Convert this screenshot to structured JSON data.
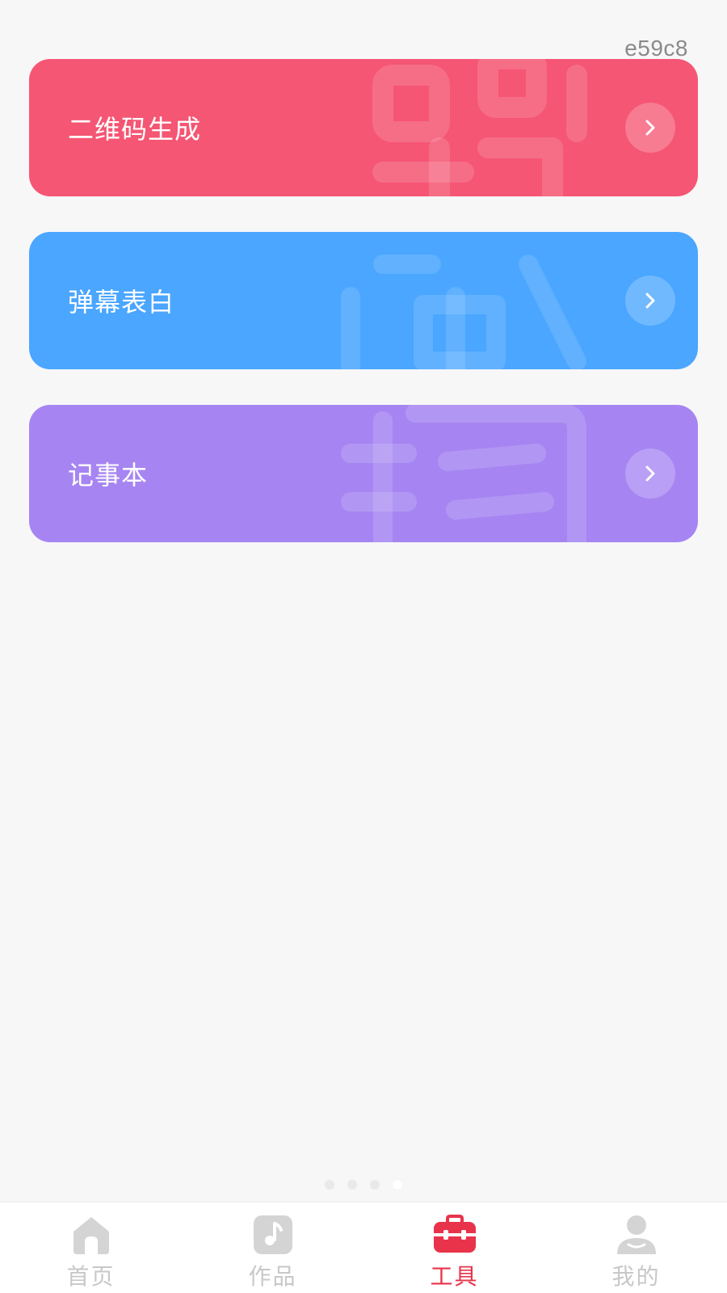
{
  "corner_tag": "e59c8",
  "cards": [
    {
      "title": "二维码生成",
      "icon": "chevron-right-icon",
      "color": "#f55673"
    },
    {
      "title": "弹幕表白",
      "icon": "chevron-right-icon",
      "color": "#4aa6ff"
    },
    {
      "title": "记事本",
      "icon": "chevron-right-icon",
      "color": "#a685f2"
    }
  ],
  "pager": {
    "count": 4,
    "active_index": 3
  },
  "tabbar": {
    "active_color": "#e8334a",
    "inactive_color": "#c8c8c8",
    "tabs": [
      {
        "label": "首页",
        "icon": "home-icon",
        "active": false
      },
      {
        "label": "作品",
        "icon": "music-note-icon",
        "active": false
      },
      {
        "label": "工具",
        "icon": "toolbox-icon",
        "active": true
      },
      {
        "label": "我的",
        "icon": "user-icon",
        "active": false
      }
    ]
  }
}
